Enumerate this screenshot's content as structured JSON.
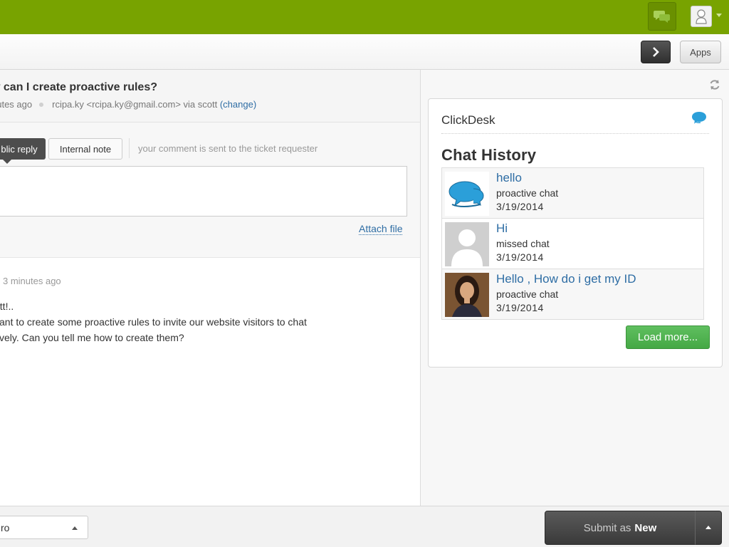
{
  "header": {
    "chat_icon": "chat-bubbles-icon",
    "avatar_icon": "user-avatar-icon",
    "accent": "#78a300"
  },
  "toolbar": {
    "apps_label": "Apps",
    "next_icon": "chevron-right-icon"
  },
  "ticket": {
    "subject": "w can I create proactive rules?",
    "time": "nutes ago",
    "requester": "rcipa.ky <rcipa.ky@gmail.com> via scott",
    "change_link": "(change)"
  },
  "reply": {
    "public_tab": "blic reply",
    "internal_tab": "Internal note",
    "hint": "your comment is sent to the ticket requester",
    "attach": "Attach file"
  },
  "comment": {
    "time": "3 minutes ago",
    "lines": [
      "ott!..",
      "vant to create some proactive rules to invite our website visitors to chat",
      "tively. Can you tell me how to create them?"
    ]
  },
  "sidebar": {
    "refresh_icon": "refresh-icon",
    "widget_title": "ClickDesk",
    "widget_logo_icon": "clickdesk-chat-icon",
    "chat_history_title": "Chat History",
    "chats": [
      {
        "message": "hello",
        "type": "proactive chat",
        "date": "3/19/2014",
        "thumb": "clickdesk-logo"
      },
      {
        "message": "Hi",
        "type": "missed chat",
        "date": "3/19/2014",
        "thumb": "default-avatar"
      },
      {
        "message": "Hello , How do i get my ID",
        "type": "proactive chat",
        "date": "3/19/2014",
        "thumb": "user-photo"
      }
    ],
    "load_more": "Load more..."
  },
  "footer": {
    "status_value": "ro",
    "submit_prefix": "Submit as",
    "submit_status": "New"
  }
}
